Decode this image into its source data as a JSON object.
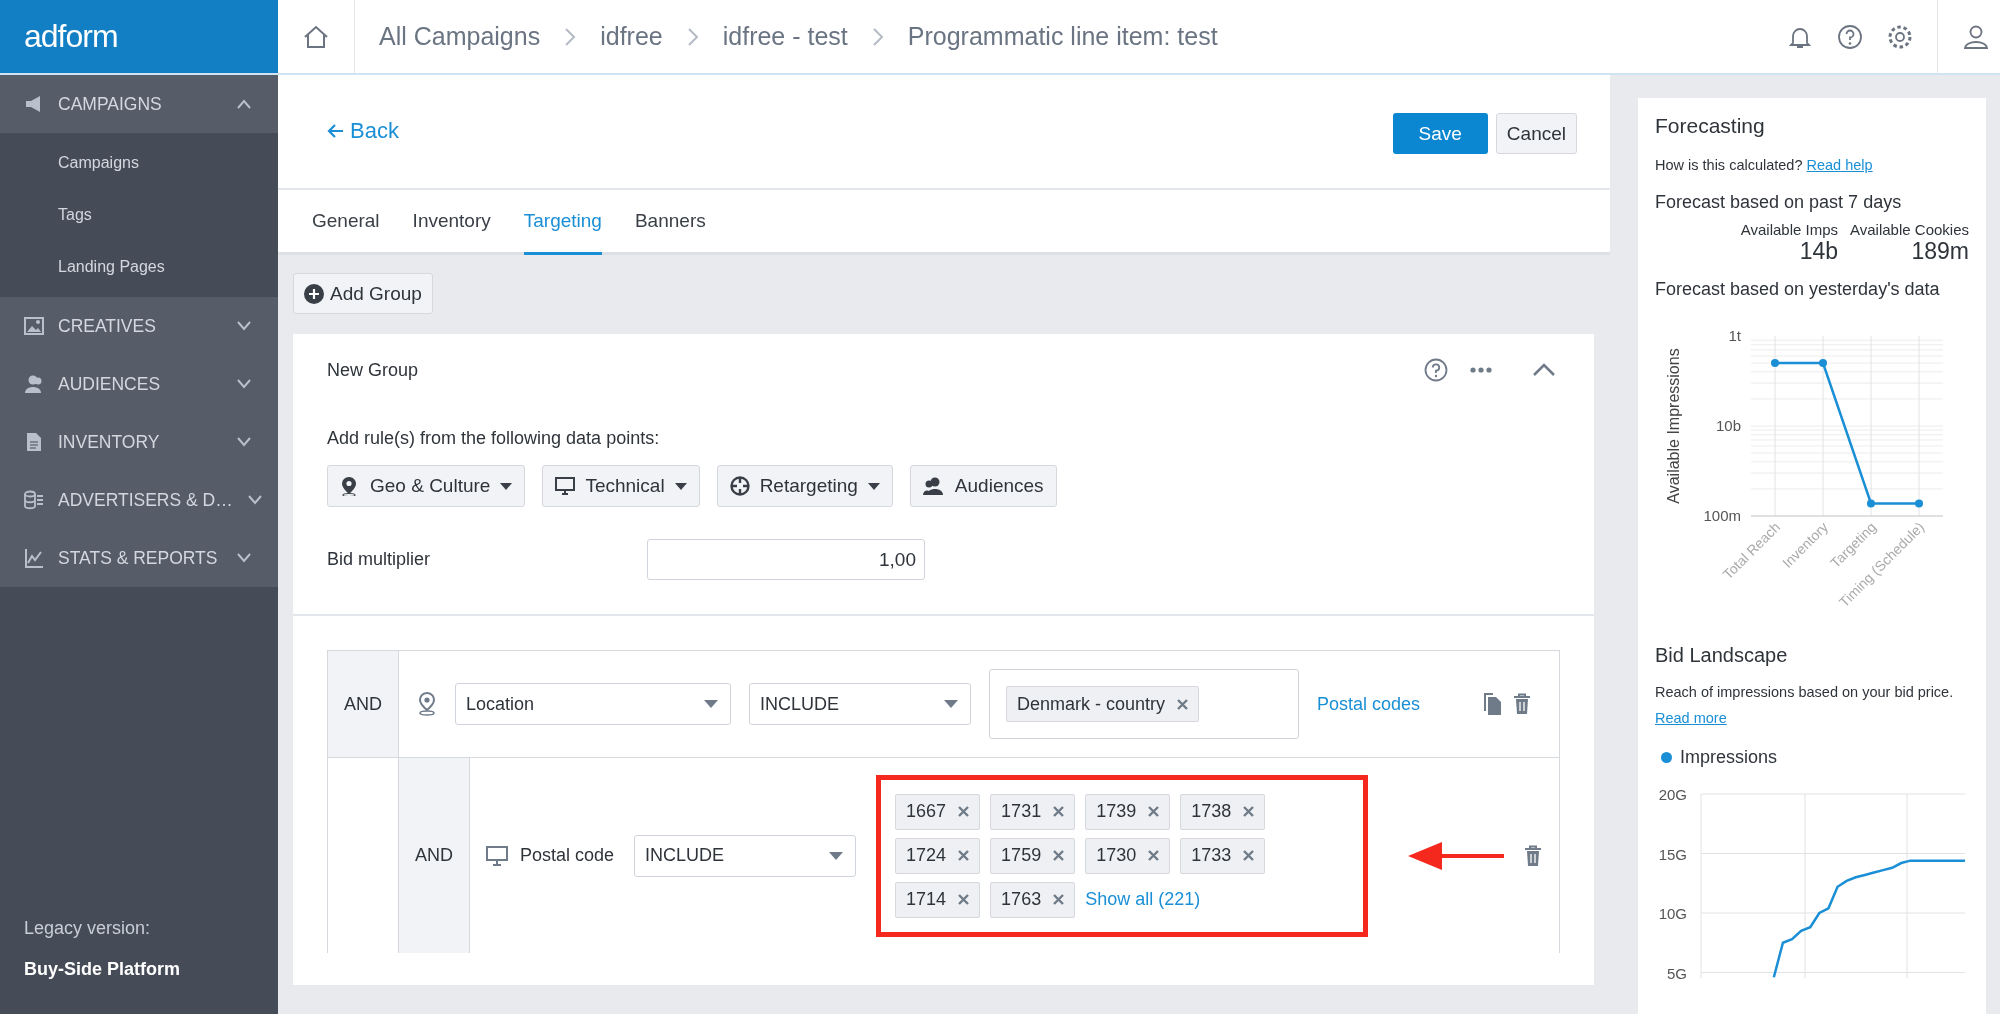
{
  "app": {
    "logo": "adform"
  },
  "breadcrumbs": [
    "All Campaigns",
    "idfree",
    "idfree - test",
    "Programmatic line item: test"
  ],
  "sidebar": {
    "groups": [
      {
        "label": "CAMPAIGNS",
        "expanded": true,
        "children": [
          {
            "label": "Campaigns"
          },
          {
            "label": "Tags"
          },
          {
            "label": "Landing Pages"
          }
        ]
      },
      {
        "label": "CREATIVES",
        "expanded": false
      },
      {
        "label": "AUDIENCES",
        "expanded": false
      },
      {
        "label": "INVENTORY",
        "expanded": false
      },
      {
        "label": "ADVERTISERS & D…",
        "expanded": false
      },
      {
        "label": "STATS & REPORTS",
        "expanded": false
      }
    ],
    "footer_label": "Legacy version:",
    "footer_link": "Buy-Side Platform"
  },
  "header": {
    "back": "Back",
    "save": "Save",
    "cancel": "Cancel"
  },
  "tabs": [
    {
      "label": "General",
      "selected": false
    },
    {
      "label": "Inventory",
      "selected": false
    },
    {
      "label": "Targeting",
      "selected": true
    },
    {
      "label": "Banners",
      "selected": false
    }
  ],
  "add_group": "Add Group",
  "group": {
    "title": "New Group",
    "expanded": true,
    "prompt": "Add rule(s) from the following data points:",
    "data_points": [
      {
        "label": "Geo & Culture",
        "has_menu": true
      },
      {
        "label": "Technical",
        "has_menu": true
      },
      {
        "label": "Retargeting",
        "has_menu": true
      },
      {
        "label": "Audiences",
        "has_menu": false
      }
    ],
    "bid_multiplier": {
      "label": "Bid multiplier",
      "value": "1,00"
    },
    "rules": [
      {
        "kind": "select",
        "nested": false,
        "connector": "AND",
        "field": "Location",
        "operator": "INCLUDE",
        "values": [
          "Denmark - country"
        ],
        "link": "Postal codes",
        "highlighted": false
      },
      {
        "kind": "fixed",
        "nested": true,
        "connector": "AND",
        "field": "Postal code",
        "operator": "INCLUDE",
        "values": [
          "1667",
          "1731",
          "1739",
          "1738",
          "1724",
          "1759",
          "1730",
          "1733",
          "1714",
          "1763"
        ],
        "link": "Show all (221)",
        "highlighted": true
      }
    ]
  },
  "forecast": {
    "title": "Forecasting",
    "help_text": "How is this calculated?",
    "help_link": "Read help",
    "past_heading": "Forecast based on past 7 days",
    "stats": [
      {
        "label": "Available Imps",
        "value": "14b"
      },
      {
        "label": "Available Cookies",
        "value": "189m"
      }
    ],
    "yesterday_heading": "Forecast based on yesterday's data",
    "chart": {
      "y_title": "Available Impressions",
      "y_labels": [
        "1t",
        "10b",
        "100m"
      ],
      "x_labels": [
        "Total Reach",
        "Inventory",
        "Targeting",
        "Timing (Schedule)"
      ]
    }
  },
  "bid_landscape": {
    "title": "Bid Landscape",
    "text": "Reach of impressions based on your bid price.",
    "link": "Read more",
    "chart_data": {
      "type": "line",
      "grid": true,
      "ylim": [
        4.5,
        20
      ],
      "series": [
        {
          "name": "Impressions",
          "color": "#1a8fd6",
          "values": [
            null,
            null,
            null,
            null,
            null,
            null,
            null,
            null,
            4.6,
            7.5,
            7.8,
            8.5,
            8.8,
            10.0,
            10.4,
            12.2,
            12.7,
            13.0,
            13.2,
            13.4,
            13.6,
            13.8,
            14.2,
            14.4,
            14.4,
            14.4,
            14.4,
            14.4,
            14.4,
            14.4
          ]
        }
      ],
      "yticks": [
        {
          "value": 5,
          "label": "5G"
        },
        {
          "value": 10,
          "label": "10G"
        },
        {
          "value": 15,
          "label": "15G"
        },
        {
          "value": 20,
          "label": "20G"
        }
      ]
    }
  }
}
